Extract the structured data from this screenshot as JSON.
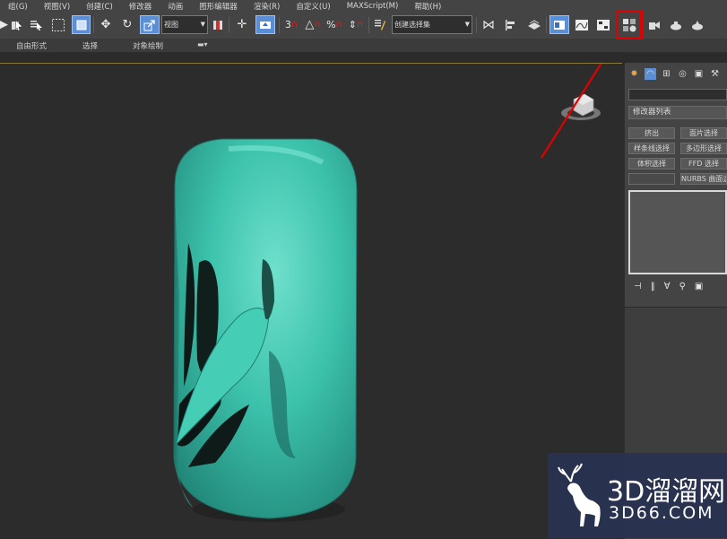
{
  "menu": {
    "items": [
      "组(G)",
      "视图(V)",
      "创建(C)",
      "修改器",
      "动画",
      "图形编辑器",
      "渲染(R)",
      "自定义(U)",
      "MAXScript(M)",
      "帮助(H)"
    ]
  },
  "toolbar": {
    "reference_coord": "视图",
    "named_selection": "创建选择集",
    "snap_label": "3",
    "percent_label": "%"
  },
  "ribbon": {
    "tabs": [
      "自由形式",
      "选择",
      "对象绘制"
    ]
  },
  "panel": {
    "modifier_list": "修改器列表",
    "buttons": [
      "挤出",
      "面片选择",
      "样条线选择",
      "多边形选择",
      "体积选择",
      "FFD 选择",
      "NURBS 曲面选"
    ]
  },
  "watermark": {
    "line1": "3D溜溜网",
    "line2": "3D66.COM"
  },
  "colors": {
    "object": "#3cc2ac",
    "annotation": "#e00000",
    "active_tool": "#5a8fd6"
  }
}
